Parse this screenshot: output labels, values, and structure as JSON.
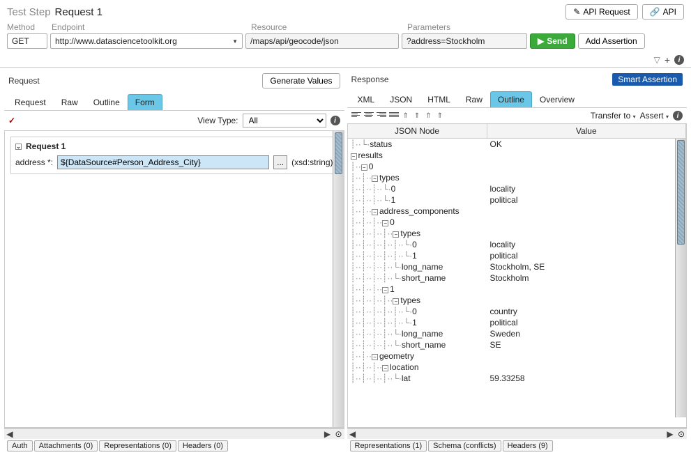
{
  "header": {
    "prefix": "Test Step",
    "name": "Request 1",
    "api_request_btn": "API Request",
    "api_btn": "API"
  },
  "labels": {
    "method": "Method",
    "endpoint": "Endpoint",
    "resource": "Resource",
    "parameters": "Parameters"
  },
  "fields": {
    "method": "GET",
    "endpoint": "http://www.datasciencetoolkit.org",
    "resource": "/maps/api/geocode/json",
    "parameters": "?address=Stockholm",
    "send": "Send",
    "add_assertion": "Add Assertion"
  },
  "request_panel": {
    "title": "Request",
    "generate_btn": "Generate Values",
    "tabs": [
      "Request",
      "Raw",
      "Outline",
      "Form"
    ],
    "active_tab": 3,
    "view_type_label": "View Type:",
    "view_type_value": "All",
    "section_title": "Request 1",
    "field_label": "address *:",
    "field_value": "${DataSource#Person_Address_City}",
    "field_type": "(xsd:string)",
    "ellipsis": "...",
    "bottom_tabs": [
      "Auth",
      "Attachments (0)",
      "Representations (0)",
      "Headers (0)"
    ],
    "checkmark": "✓"
  },
  "response_panel": {
    "title": "Response",
    "smart_btn": "Smart Assertion",
    "tabs": [
      "XML",
      "JSON",
      "HTML",
      "Raw",
      "Outline",
      "Overview"
    ],
    "active_tab": 4,
    "transfer_label": "Transfer to",
    "assert_label": "Assert",
    "th_node": "JSON Node",
    "th_value": "Value",
    "rows": [
      {
        "indent": 1,
        "toggle": "",
        "node": "status",
        "value": "OK"
      },
      {
        "indent": 0,
        "toggle": "−",
        "node": "results",
        "value": ""
      },
      {
        "indent": 1,
        "toggle": "−",
        "node": "0",
        "value": ""
      },
      {
        "indent": 2,
        "toggle": "−",
        "node": "types",
        "value": ""
      },
      {
        "indent": 3,
        "toggle": "",
        "node": "0",
        "value": "locality"
      },
      {
        "indent": 3,
        "toggle": "",
        "node": "1",
        "value": "political"
      },
      {
        "indent": 2,
        "toggle": "−",
        "node": "address_components",
        "value": ""
      },
      {
        "indent": 3,
        "toggle": "−",
        "node": "0",
        "value": ""
      },
      {
        "indent": 4,
        "toggle": "−",
        "node": "types",
        "value": ""
      },
      {
        "indent": 5,
        "toggle": "",
        "node": "0",
        "value": "locality"
      },
      {
        "indent": 5,
        "toggle": "",
        "node": "1",
        "value": "political"
      },
      {
        "indent": 4,
        "toggle": "",
        "node": "long_name",
        "value": "Stockholm, SE"
      },
      {
        "indent": 4,
        "toggle": "",
        "node": "short_name",
        "value": "Stockholm"
      },
      {
        "indent": 3,
        "toggle": "−",
        "node": "1",
        "value": ""
      },
      {
        "indent": 4,
        "toggle": "−",
        "node": "types",
        "value": ""
      },
      {
        "indent": 5,
        "toggle": "",
        "node": "0",
        "value": "country"
      },
      {
        "indent": 5,
        "toggle": "",
        "node": "1",
        "value": "political"
      },
      {
        "indent": 4,
        "toggle": "",
        "node": "long_name",
        "value": "Sweden"
      },
      {
        "indent": 4,
        "toggle": "",
        "node": "short_name",
        "value": "SE"
      },
      {
        "indent": 2,
        "toggle": "−",
        "node": "geometry",
        "value": ""
      },
      {
        "indent": 3,
        "toggle": "−",
        "node": "location",
        "value": ""
      },
      {
        "indent": 4,
        "toggle": "",
        "node": "lat",
        "value": "59.33258"
      }
    ],
    "bottom_tabs": [
      "Representations (1)",
      "Schema (conflicts)",
      "Headers (9)"
    ]
  }
}
